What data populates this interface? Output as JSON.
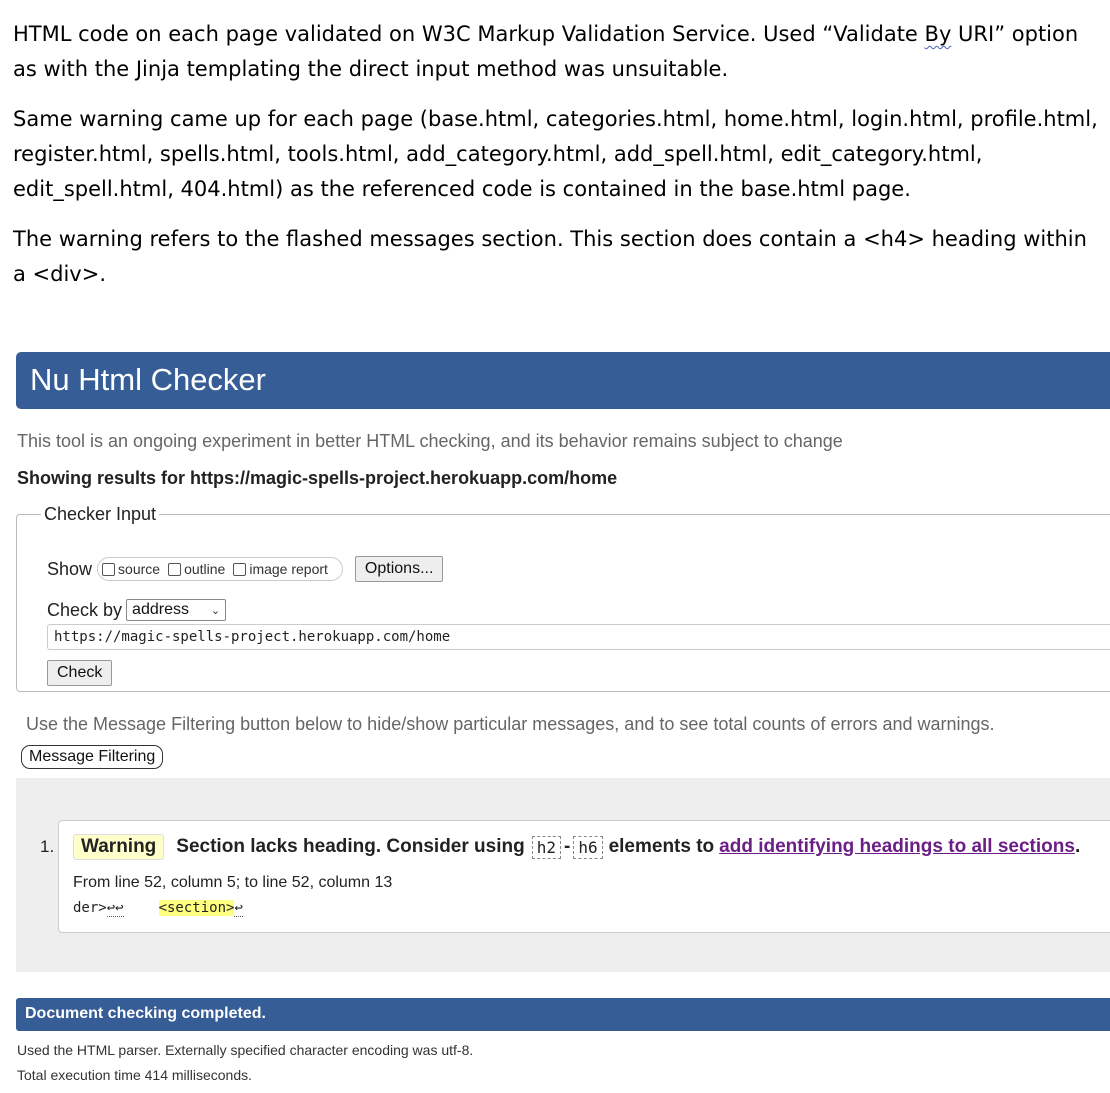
{
  "document": {
    "paragraph1_before": "HTML code on each page validated on W3C Markup Validation Service. Used “Validate ",
    "paragraph1_flagged": "By",
    "paragraph1_after": " URI” option as with the Jinja templating the direct input method was unsuitable.",
    "paragraph2": "Same warning came up for each page (base.html, categories.html, home.html, login.html, profile.html, register.html, spells.html, tools.html, add_category.html, add_spell.html, edit_category.html, edit_spell.html, 404.html) as the referenced code is contained in the base.html page.",
    "paragraph3": "The warning refers to the flashed messages section. This section does contain a <h4> heading within a <div>."
  },
  "checker": {
    "title": "Nu Html Checker",
    "tagline": "This tool is an ongoing experiment in better HTML checking, and its behavior remains subject to change",
    "showing_prefix": "Showing results for ",
    "showing_url": "https://magic-spells-project.herokuapp.com/home",
    "input_legend": "Checker Input",
    "show_label": "Show",
    "show_options": [
      "source",
      "outline",
      "image report"
    ],
    "options_button": "Options...",
    "check_by_label": "Check by",
    "check_by_value": "address",
    "url_value": "https://magic-spells-project.herokuapp.com/home",
    "check_button": "Check",
    "filter_note": "Use the Message Filtering button below to hide/show particular messages, and to see total counts of errors and warnings.",
    "filter_button": "Message Filtering"
  },
  "messages": [
    {
      "number": "1.",
      "type": "Warning",
      "text_before": "Section lacks heading. Consider using",
      "code1": "h2",
      "dash": "-",
      "code2": "h6",
      "text_after": "elements to",
      "link": "add identifying headings to all sections",
      "period": ".",
      "location": "From line 52, column 5; to line 52, column 13",
      "extract_before": "der>",
      "extract_newlines": "↩↩",
      "extract_highlight": "<section>",
      "extract_after": "↩"
    }
  ],
  "footer": {
    "completed": "Document checking completed.",
    "parser_note": "Used the HTML parser. Externally specified character encoding was utf-8.",
    "timing": "Total execution time 414 milliseconds."
  },
  "colors": {
    "banner": "#365d95",
    "warning_badge": "#ffffcc",
    "link": "#6b1f86",
    "highlight": "#ffff7f"
  }
}
